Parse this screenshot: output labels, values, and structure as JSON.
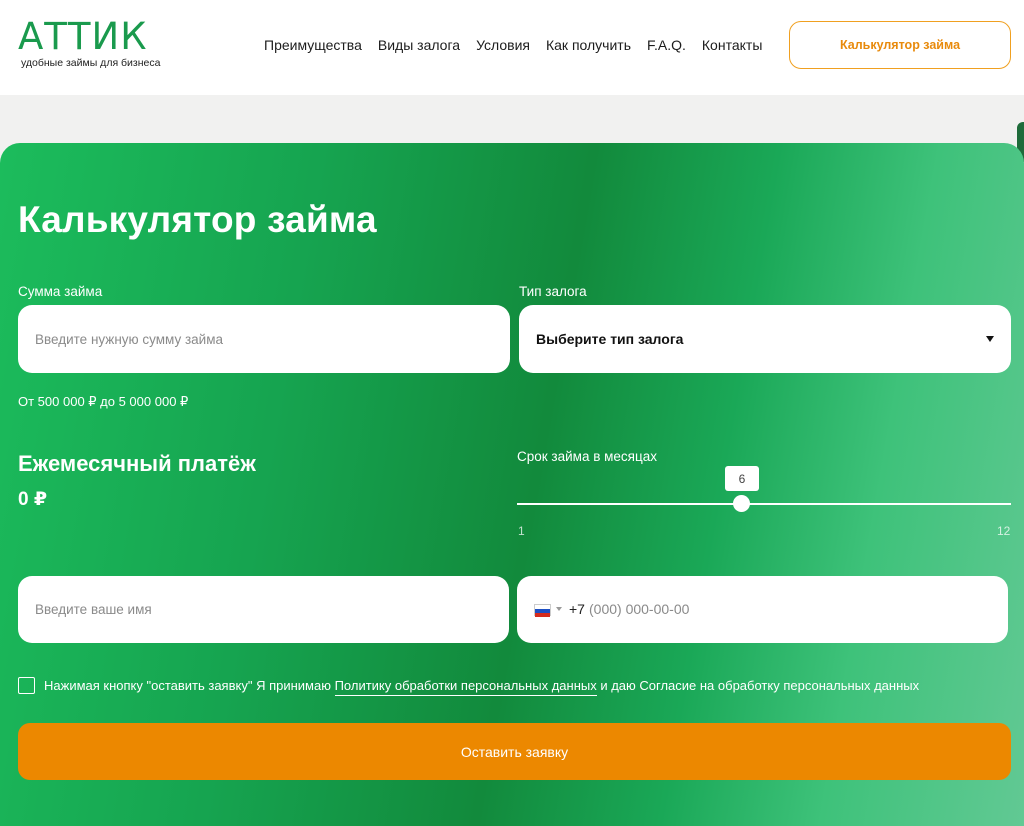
{
  "header": {
    "logo_text": "АТТИК",
    "logo_tagline": "удобные займы для бизнеса",
    "nav": [
      "Преимущества",
      "Виды залога",
      "Условия",
      "Как получить",
      "F.A.Q.",
      "Контакты"
    ],
    "cta_label": "Калькулятор займа"
  },
  "calculator": {
    "title": "Калькулятор займа",
    "amount_label": "Сумма займа",
    "amount_placeholder": "Введите нужную сумму займа",
    "amount_hint": "От 500 000 ₽ до 5 000 000 ₽",
    "collateral_label": "Тип залога",
    "collateral_selected": "Выберите тип залога",
    "monthly_label": "Ежемесячный платёж",
    "monthly_value": "0 ₽",
    "term_label": "Срок займа в месяцах",
    "term": {
      "value": "6",
      "min": "1",
      "max": "12"
    },
    "name_placeholder": "Введите ваше имя",
    "phone": {
      "code": "+7",
      "placeholder": "(000) 000-00-00",
      "country": "ru-flag-icon"
    },
    "consent_before": "Нажимая кнопку \"оставить заявку\" Я принимаю ",
    "consent_link": "Политику обработки персональных данных",
    "consent_after": " и даю Согласие на обработку персональных данных",
    "submit_label": "Оставить заявку"
  },
  "colors": {
    "brand_green": "#1a9a4d",
    "accent_orange": "#ec8800"
  }
}
